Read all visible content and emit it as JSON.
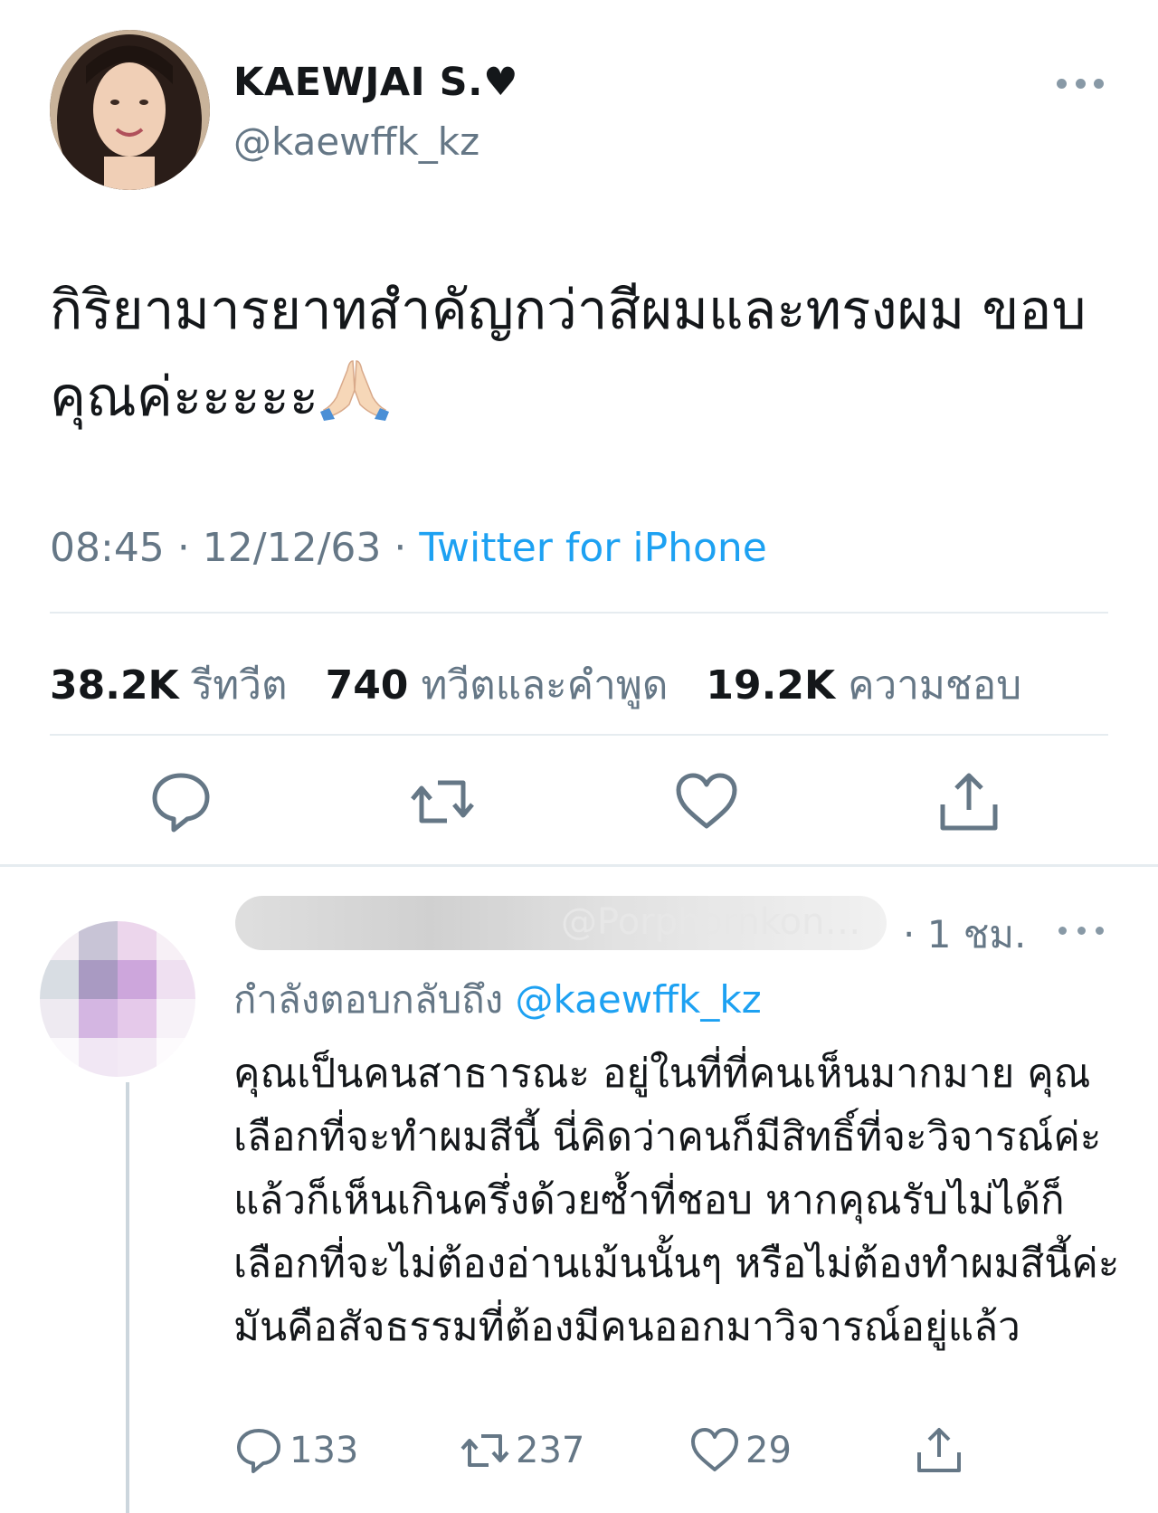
{
  "main_tweet": {
    "display_name": "KAEWJAI S.♥",
    "handle": "@kaewffk_kz",
    "text": "กิริยามารยาทสำคัญกว่าสีผมและทรงผม ขอบคุณค่ะะะะะ",
    "emoji": "folded-hands",
    "time": "08:45",
    "date": "12/12/63",
    "source": "Twitter for iPhone",
    "stats": {
      "retweets_count": "38.2K",
      "retweets_label": "รีทวีต",
      "quotes_count": "740",
      "quotes_label": "ทวีตและคำพูด",
      "likes_count": "19.2K",
      "likes_label": "ความชอบ"
    }
  },
  "reply": {
    "blurred_name": "@Porphornkon…",
    "time": "1 ชม.",
    "replying_to_label": "กำลังตอบกลับถึง",
    "replying_to_handle": "@kaewffk_kz",
    "text": "คุณเป็นคนสาธารณะ อยู่ในที่ที่คนเห็นมากมาย คุณเลือกที่จะทำผมสีนี้ นี่คิดว่าคนก็มีสิทธิ์ที่จะวิจารณ์ค่ะ แล้วก็เห็นเกินครึ่งด้วยซ้ำที่ชอบ หากคุณรับไม่ได้ก็เลือกที่จะไม่ต้องอ่านเม้นนั้นๆ หรือไม่ต้องทำผมสีนี้ค่ะ มันคือสัจธรรมที่ต้องมีคนออกมาวิจารณ์อยู่แล้ว",
    "replies_count": "133",
    "retweets_count": "237",
    "likes_count": "29"
  },
  "colors": {
    "link": "#1da1f2",
    "secondary_text": "#657786",
    "icon": "#657786",
    "divider": "#e6ecf0"
  }
}
